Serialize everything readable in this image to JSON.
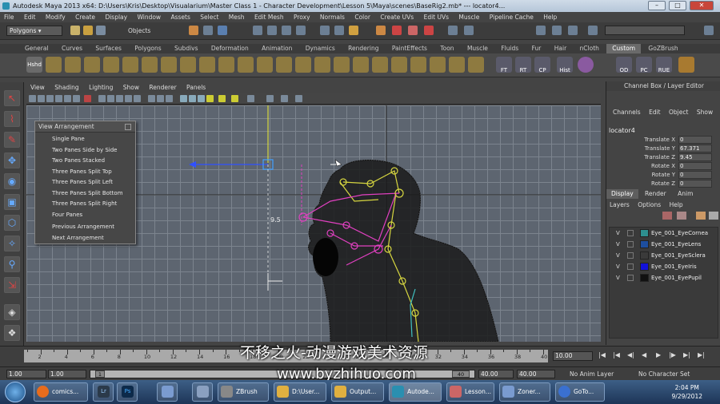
{
  "window": {
    "title": "Autodesk Maya 2013 x64: D:\\Users\\Kris\\Desktop\\Visualarium\\Master Class 1 - Character Development\\Lesson 5\\Maya\\scenes\\BaseRig2.mb*  ---  locator4..."
  },
  "menubar": [
    "File",
    "Edit",
    "Modify",
    "Create",
    "Display",
    "Window",
    "Assets",
    "Select",
    "Mesh",
    "Edit Mesh",
    "Proxy",
    "Normals",
    "Color",
    "Create UVs",
    "Edit UVs",
    "Muscle",
    "Pipeline Cache",
    "Help"
  ],
  "statusline": {
    "mode": "Polygons",
    "selection_mask": "Objects"
  },
  "shelf": {
    "tabs": [
      "General",
      "Curves",
      "Surfaces",
      "Polygons",
      "Subdivs",
      "Deformation",
      "Animation",
      "Dynamics",
      "Rendering",
      "PaintEffects",
      "Toon",
      "Muscle",
      "Fluids",
      "Fur",
      "Hair",
      "nCloth",
      "Custom",
      "GoZBrush"
    ],
    "active_tab": "Custom",
    "first_button": "Hshd",
    "labeled_buttons": [
      "FT",
      "RT",
      "CP",
      "Hist",
      "OD",
      "PC",
      "RUE"
    ]
  },
  "viewport": {
    "menu": [
      "View",
      "Shading",
      "Lighting",
      "Show",
      "Renderer",
      "Panels"
    ],
    "annotation": "9.5"
  },
  "view_arrangement": {
    "title": "View Arrangement",
    "items": [
      "Single Pane",
      "Two Panes Side by Side",
      "Two Panes Stacked",
      "Three Panes Split Top",
      "Three Panes Split Left",
      "Three Panes Split Bottom",
      "Three Panes Split Right",
      "Four Panes"
    ],
    "nav_items": [
      "Previous Arrangement",
      "Next Arrangement"
    ]
  },
  "channel_box": {
    "title": "Channel Box / Layer Editor",
    "menu": [
      "Channels",
      "Edit",
      "Object",
      "Show"
    ],
    "object_name": "locator4",
    "attributes": [
      {
        "name": "Translate X",
        "value": "0"
      },
      {
        "name": "Translate Y",
        "value": "67.371"
      },
      {
        "name": "Translate Z",
        "value": "9.45"
      },
      {
        "name": "Rotate X",
        "value": "0"
      },
      {
        "name": "Rotate Y",
        "value": "0"
      },
      {
        "name": "Rotate Z",
        "value": "0"
      }
    ]
  },
  "layer_editor": {
    "tabs": [
      "Display",
      "Render",
      "Anim"
    ],
    "active_tab": "Display",
    "menu": [
      "Layers",
      "Options",
      "Help"
    ],
    "layers": [
      {
        "visible": "V",
        "name": "Eye_001_EyeCornea",
        "color": "#2e8f8f"
      },
      {
        "visible": "V",
        "name": "Eye_001_EyeLens",
        "color": "#1d4e9e"
      },
      {
        "visible": "V",
        "name": "Eye_001_EyeSclera",
        "color": "#3a3a3a"
      },
      {
        "visible": "V",
        "name": "Eye_001_EyeIris",
        "color": "#1212d8"
      },
      {
        "visible": "V",
        "name": "Eye_001_EyePupil",
        "color": "#111111"
      }
    ]
  },
  "timeline": {
    "ticks": [
      "2",
      "4",
      "6",
      "8",
      "10",
      "12",
      "14",
      "16",
      "18",
      "20",
      "22",
      "24",
      "26",
      "28",
      "30",
      "32",
      "34",
      "36",
      "38",
      "40"
    ],
    "current_frame": "10.00"
  },
  "range_slider": {
    "start": "1.00",
    "min": "1.00",
    "knob": "1",
    "knob_end": "40",
    "end": "40.00",
    "max": "40.00",
    "anim_layer": "No Anim Layer",
    "character_set": "No Character Set"
  },
  "taskbar": {
    "items": [
      "comics...",
      "ZBrush",
      "D:\\User...",
      "Output...",
      "Autode...",
      "Lesson...",
      "Zoner...",
      "GoTo..."
    ],
    "time": "2:04 PM",
    "date": "9/29/2012"
  },
  "watermark": {
    "line1": "不移之火-动漫游戏美术资源",
    "line2": "www.byzhihuo.com"
  }
}
